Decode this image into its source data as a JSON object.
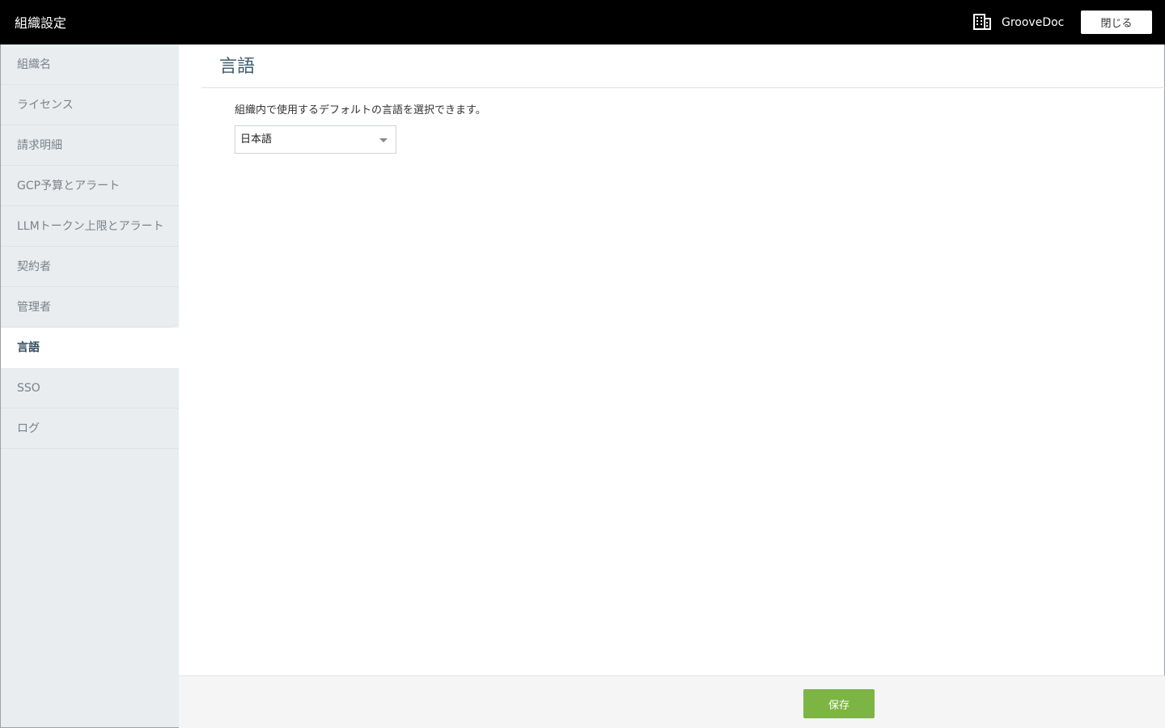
{
  "header": {
    "title": "組織設定",
    "org_icon": "building-icon",
    "org_name": "GrooveDoc",
    "close_label": "閉じる"
  },
  "sidebar": {
    "items": [
      {
        "label": "組織名"
      },
      {
        "label": "ライセンス"
      },
      {
        "label": "請求明細"
      },
      {
        "label": "GCP予算とアラート"
      },
      {
        "label": "LLMトークン上限とアラート"
      },
      {
        "label": "契約者"
      },
      {
        "label": "管理者"
      },
      {
        "label": "言語",
        "active": true
      },
      {
        "label": "SSO"
      },
      {
        "label": "ログ"
      }
    ]
  },
  "main": {
    "title": "言語",
    "description": "組織内で使用するデフォルトの言語を選択できます。",
    "language_select": {
      "selected": "日本語"
    }
  },
  "footer": {
    "save_label": "保存"
  },
  "colors": {
    "topbar": "#000000",
    "sidebar": "#e9edf0",
    "save_button": "#7db544",
    "title": "#3d5a6c"
  }
}
